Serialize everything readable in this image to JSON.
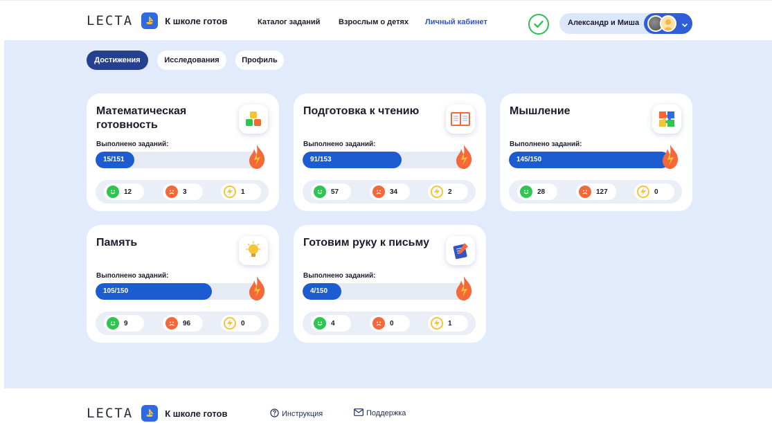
{
  "header": {
    "brand_word": "LECTA",
    "brand_title": "К школе готов",
    "nav": [
      "Каталог заданий",
      "Взрослым о детях",
      "Личный кабинет"
    ],
    "user_name": "Александр и Миша"
  },
  "tabs": [
    "Достижения",
    "Исследования",
    "Профиль"
  ],
  "done_label": "Выполнено заданий:",
  "cards": [
    {
      "title": "Математическая готовность",
      "icon": "number-blocks-icon",
      "progress_text": "15/151",
      "done": 15,
      "total": 151,
      "correct": "12",
      "wrong": "3",
      "bonus": "1"
    },
    {
      "title": "Подготовка к чтению",
      "icon": "open-book-icon",
      "progress_text": "91/153",
      "done": 91,
      "total": 153,
      "correct": "57",
      "wrong": "34",
      "bonus": "2"
    },
    {
      "title": "Мышление",
      "icon": "puzzle-icon",
      "progress_text": "145/150",
      "done": 145,
      "total": 150,
      "correct": "28",
      "wrong": "127",
      "bonus": "0"
    },
    {
      "title": "Память",
      "icon": "lightbulb-icon",
      "progress_text": "105/150",
      "done": 105,
      "total": 150,
      "correct": "9",
      "wrong": "96",
      "bonus": "0"
    },
    {
      "title": "Готовим руку к письму",
      "icon": "notebook-pencil-icon",
      "progress_text": "4/150",
      "done": 4,
      "total": 150,
      "correct": "4",
      "wrong": "0",
      "bonus": "1"
    }
  ],
  "footer": {
    "brand_word": "LECTA",
    "brand_title": "К школе готов",
    "instruction": "Инструкция",
    "support": "Поддержка"
  },
  "colors": {
    "accent": "#1d5bd0",
    "active_tab": "#25408f",
    "background": "#e2ebfb",
    "correct": "#2ec553",
    "wrong": "#f5683a",
    "bonus": "#f7c533"
  }
}
